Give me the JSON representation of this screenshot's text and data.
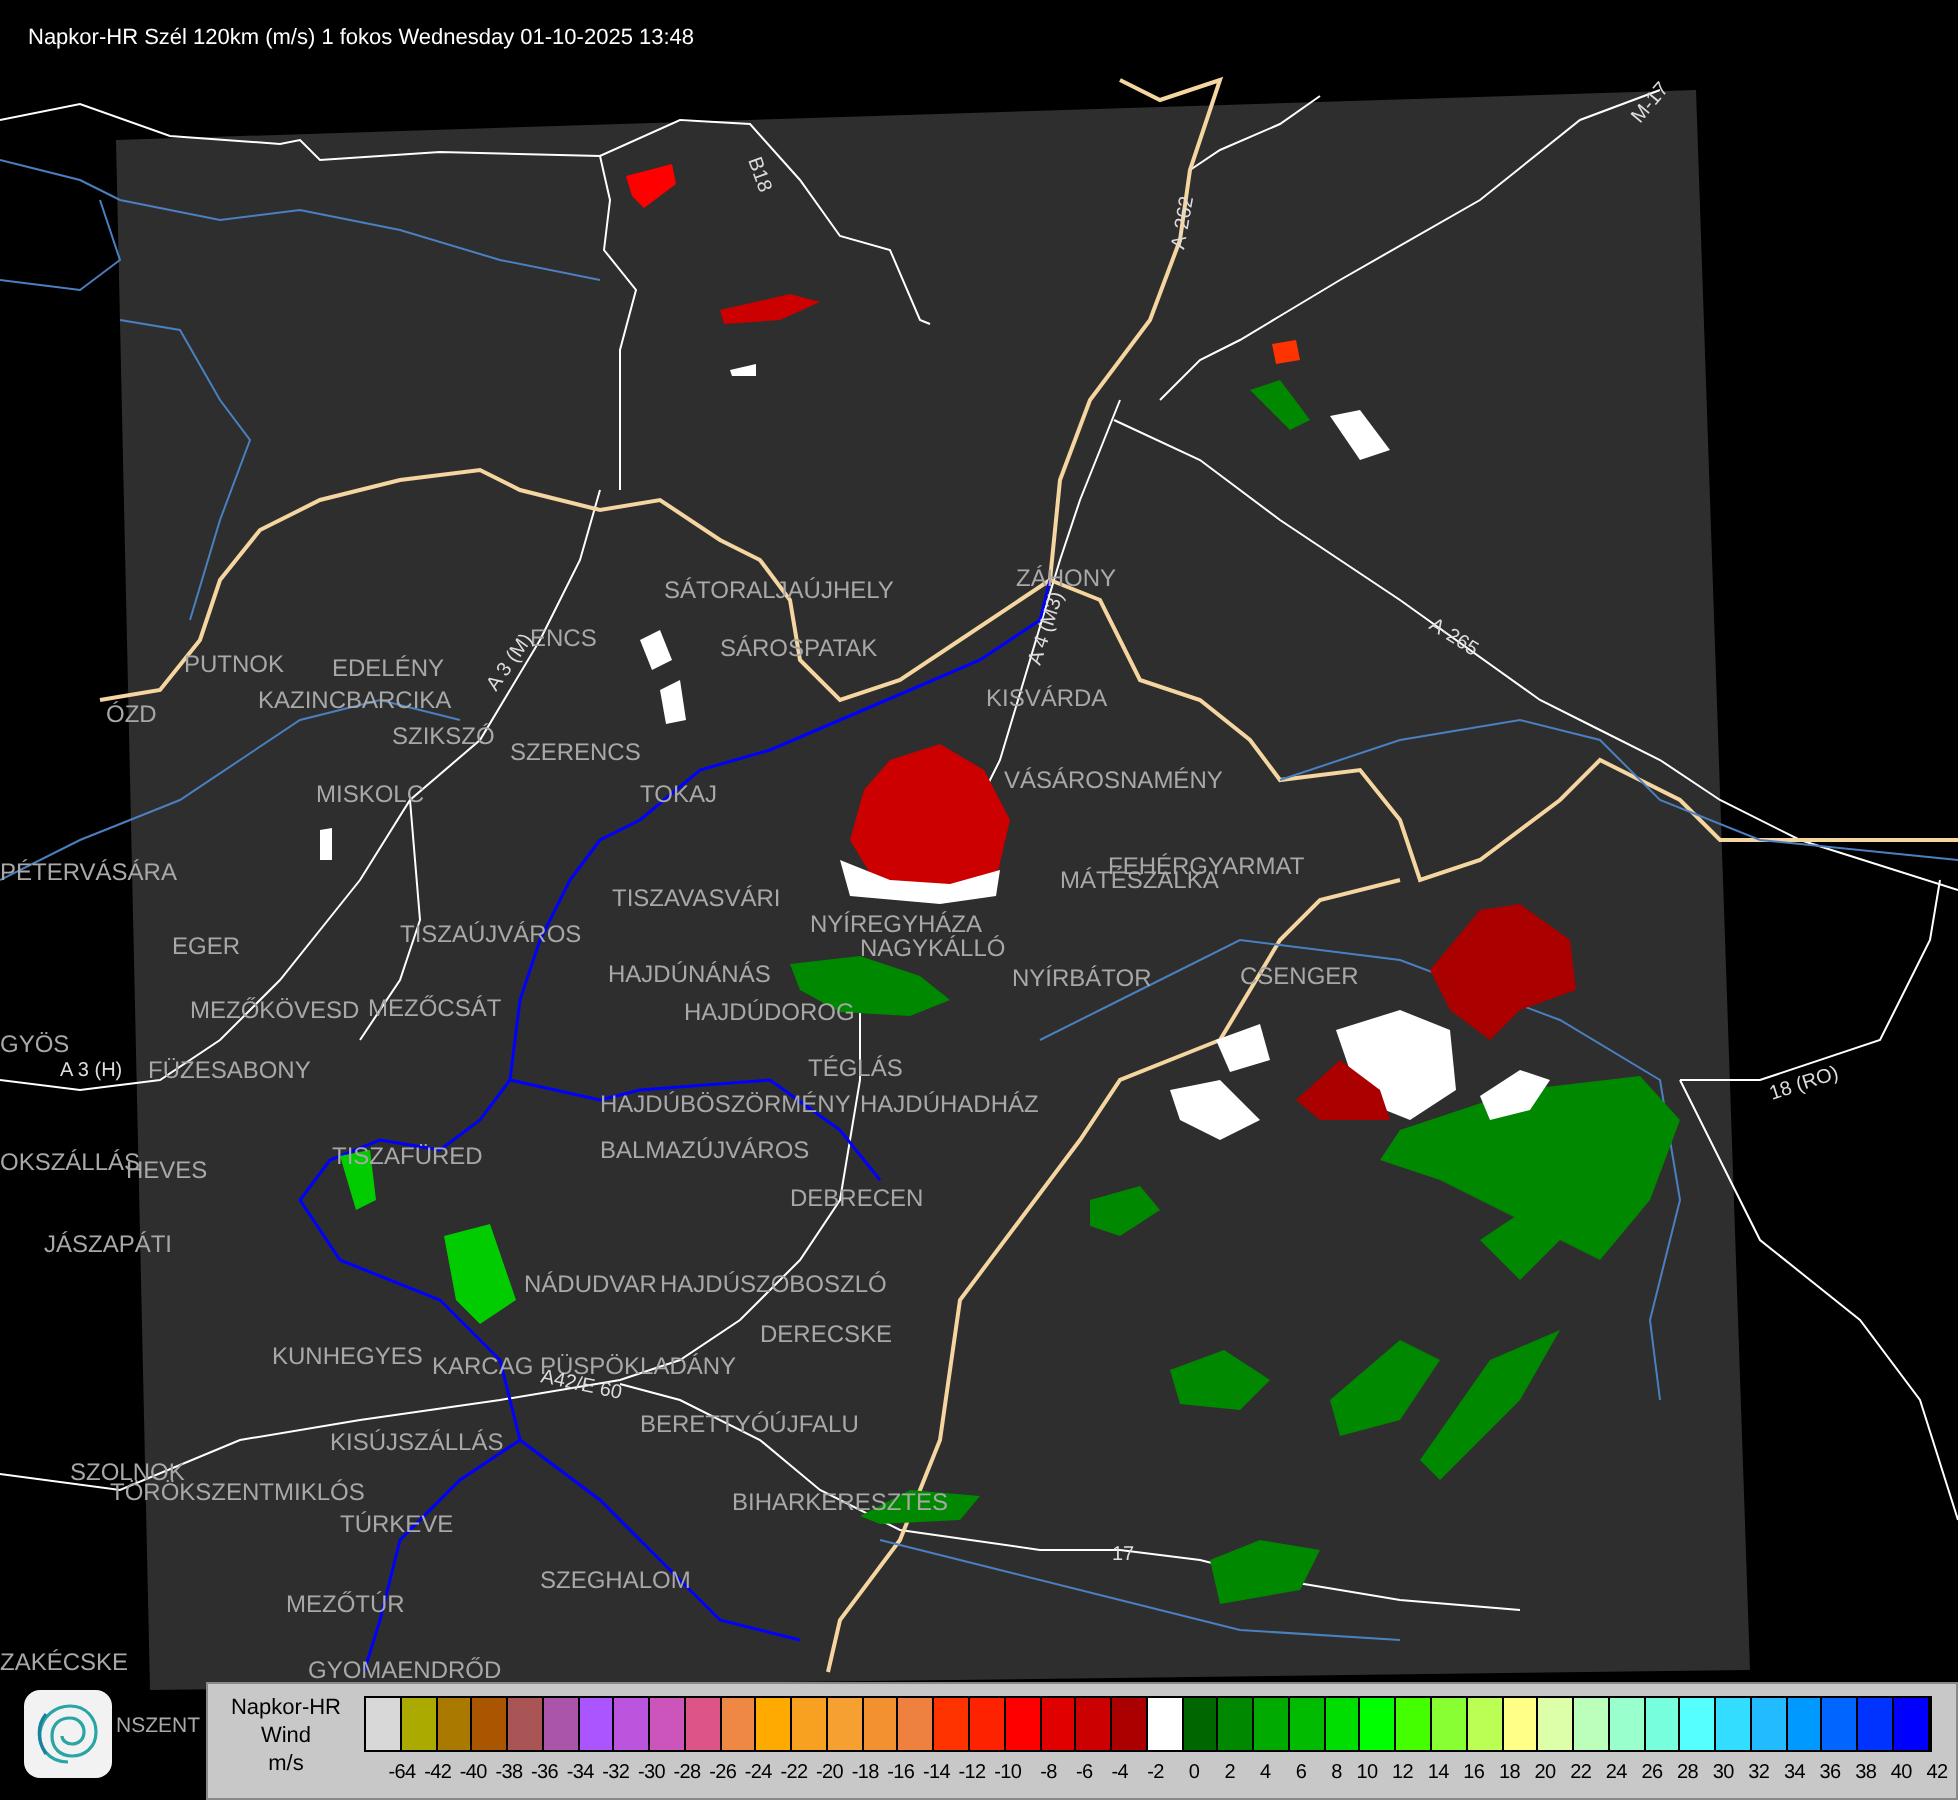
{
  "title": "Napkor-HR Szél 120km (m/s) 1 fokos Wednesday 01-10-2025 13:48",
  "map": {
    "places": [
      "SÁTORALJAÚJHELY",
      "SÁROSPATAK",
      "ZÁHONY",
      "PUTNOK",
      "EDELÉNY",
      "ENCS",
      "KAZINCBARCIKA",
      "KISVÁRDA",
      "SZIKSZÓ",
      "SZERENCS",
      "VÁSÁROSNAMÉNY",
      "TOKAJ",
      "ÓZD",
      "MISKOLC",
      "PÉTERVÁSÁRA",
      "FEHÉRGYARMAT",
      "MÁTÉSZALKA",
      "TISZAVASVÁRI",
      "NYÍREGYHÁZA",
      "TISZAÚJVÁROS",
      "EGER",
      "NAGYKÁLLÓ",
      "HAJDÚNÁNÁS",
      "NYÍRBÁTOR",
      "CSENGER",
      "MEZŐKÖVESD",
      "MEZŐCSÁT",
      "HAJDÚDOROG",
      "GYÖS",
      "FÜZESABONY",
      "TÉGLÁS",
      "HAJDÚBÖSZÖRMÉNY",
      "HAJDÚHADHÁZ",
      "OKSZÁLLÁS",
      "HEVES",
      "TISZAFÜRED",
      "BALMAZÚJVÁROS",
      "DEBRECEN",
      "JÁSZAPÁTI",
      "NÁDUDVAR",
      "HAJDÚSZOBOSZLÓ",
      "DERECSKE",
      "KUNHEGYES",
      "KARCAG",
      "PÜSPÖKLADÁNY",
      "BERETTYÓÚJFALU",
      "KISÚJSZÁLLÁS",
      "SZOLNOK",
      "TÖRÖKSZENTMIKLÓS",
      "BIHARKERESZTES",
      "TÚRKEVE",
      "SZEGHALOM",
      "MEZŐTÚR",
      "ZAKÉCSKE",
      "GYOMAENDRŐD",
      "NSZENT"
    ],
    "roads": [
      "B18",
      "A-262",
      "M-17",
      "A-265",
      "A 4 (M3)",
      "A 3 (M)",
      "A 3 (H)",
      "18 (RO)",
      "17",
      "A42/E 60"
    ]
  },
  "legend": {
    "title": "Napkor-HR",
    "subtitle": "Wind",
    "unit": "m/s",
    "cells": [
      {
        "color": "#d8d8d8"
      },
      {
        "color": "#aaaa00"
      },
      {
        "color": "#aa7a00"
      },
      {
        "color": "#aa5500"
      },
      {
        "color": "#aa5555"
      },
      {
        "color": "#aa55aa"
      },
      {
        "color": "#aa55ff"
      },
      {
        "color": "#bb55dd"
      },
      {
        "color": "#cc55bb"
      },
      {
        "color": "#dd5588"
      },
      {
        "color": "#ee8844"
      },
      {
        "color": "#ffaa00"
      },
      {
        "color": "#f8a020"
      },
      {
        "color": "#f5a030"
      },
      {
        "color": "#f39030"
      },
      {
        "color": "#ee8040"
      },
      {
        "color": "#ff3300"
      },
      {
        "color": "#ff2200"
      },
      {
        "color": "#ff0000"
      },
      {
        "color": "#e00000"
      },
      {
        "color": "#cc0000"
      },
      {
        "color": "#aa0000"
      },
      {
        "color": "#ffffff"
      },
      {
        "color": "#006600"
      },
      {
        "color": "#008800"
      },
      {
        "color": "#00aa00"
      },
      {
        "color": "#00bb00"
      },
      {
        "color": "#00dd00"
      },
      {
        "color": "#00ff00"
      },
      {
        "color": "#44ff00"
      },
      {
        "color": "#88ff33"
      },
      {
        "color": "#bbff55"
      },
      {
        "color": "#ffff88"
      },
      {
        "color": "#ddffaa"
      },
      {
        "color": "#bbffbb"
      },
      {
        "color": "#99ffcc"
      },
      {
        "color": "#77ffdd"
      },
      {
        "color": "#55ffff"
      },
      {
        "color": "#33ddff"
      },
      {
        "color": "#22bbff"
      },
      {
        "color": "#0099ff"
      },
      {
        "color": "#0066ff"
      },
      {
        "color": "#0033ff"
      },
      {
        "color": "#0000ff"
      }
    ],
    "ticks": [
      "-64",
      "-42",
      "-40",
      "-38",
      "-36",
      "-34",
      "-32",
      "-30",
      "-28",
      "-26",
      "-24",
      "-22",
      "-20",
      "-18",
      "-16",
      "-14",
      "-12",
      "-10",
      "-8",
      "-6",
      "-4",
      "-2",
      "0",
      "2",
      "4",
      "6",
      "8",
      "10",
      "12",
      "14",
      "16",
      "18",
      "20",
      "22",
      "24",
      "26",
      "28",
      "30",
      "32",
      "34",
      "36",
      "38",
      "40",
      "42"
    ]
  }
}
